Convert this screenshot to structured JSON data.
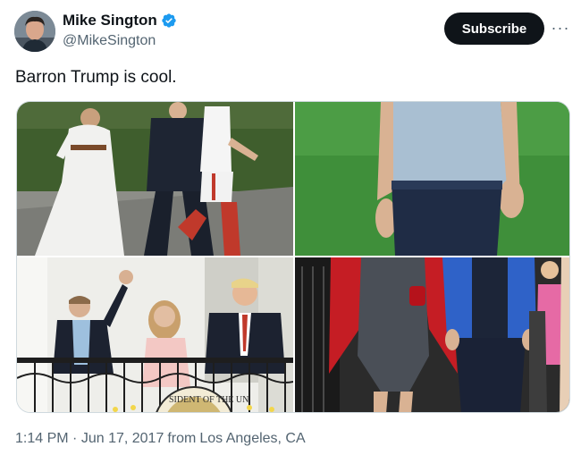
{
  "author": {
    "display_name": "Mike Sington",
    "handle": "@MikeSington",
    "verified": true,
    "verified_color": "#1d9bf0"
  },
  "actions": {
    "subscribe_label": "Subscribe",
    "more_label": "···"
  },
  "tweet": {
    "text": "Barron Trump is cool.",
    "time": "1:14 PM",
    "separator": "·",
    "date": "Jun 17, 2017",
    "location_prefix": "from",
    "location": "Los Angeles, CA"
  },
  "media": {
    "count": 4,
    "seal_text": "SIDENT OF THE UN"
  },
  "colors": {
    "text_primary": "#0f1419",
    "text_secondary": "#536471",
    "subscribe_bg": "#0f1419",
    "border": "#cfd9de"
  }
}
